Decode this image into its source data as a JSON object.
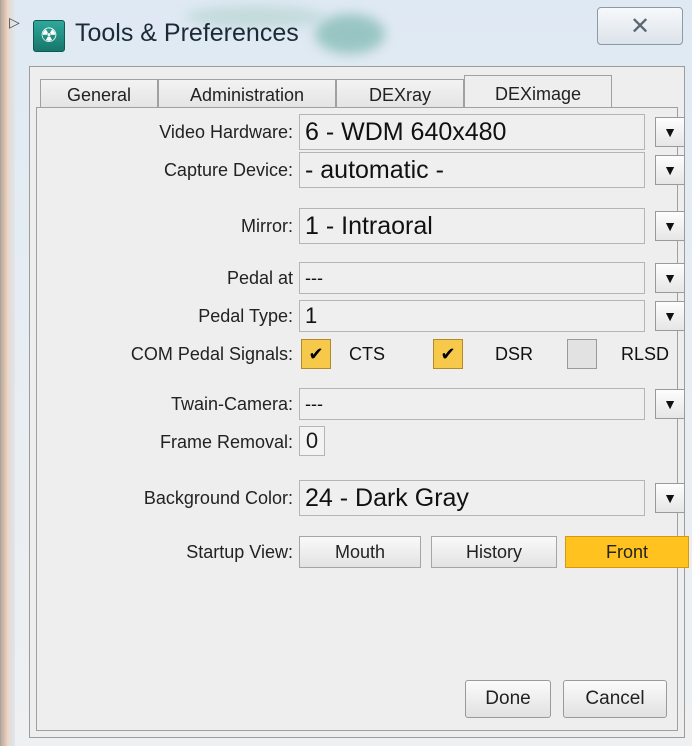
{
  "window": {
    "title": "Tools & Preferences",
    "close_glyph": "✕",
    "icon": "radiation-icon"
  },
  "tabs": [
    {
      "label": "General",
      "active": false
    },
    {
      "label": "Administration",
      "active": false
    },
    {
      "label": "DEXray",
      "active": false
    },
    {
      "label": "DEXimage",
      "active": true
    }
  ],
  "form": {
    "video_hardware": {
      "label": "Video Hardware:",
      "value": "6 - WDM 640x480"
    },
    "capture_device": {
      "label": "Capture Device:",
      "value": "- automatic -"
    },
    "mirror": {
      "label": "Mirror:",
      "value": "1 - Intraoral"
    },
    "pedal_at": {
      "label": "Pedal at",
      "value": "---"
    },
    "pedal_type": {
      "label": "Pedal Type:",
      "value": "1"
    },
    "com_pedal_signals": {
      "label": "COM Pedal Signals:",
      "options": [
        {
          "label": "CTS",
          "checked": true
        },
        {
          "label": "DSR",
          "checked": true
        },
        {
          "label": "RLSD",
          "checked": false
        }
      ]
    },
    "twain_camera": {
      "label": "Twain-Camera:",
      "value": "---"
    },
    "frame_removal": {
      "label": "Frame Removal:",
      "value": "0"
    },
    "background_color": {
      "label": "Background Color:",
      "value": "24 - Dark Gray"
    },
    "startup_view": {
      "label": "Startup View:",
      "options": [
        {
          "label": "Mouth",
          "active": false
        },
        {
          "label": "History",
          "active": false
        },
        {
          "label": "Front",
          "active": true
        }
      ]
    }
  },
  "buttons": {
    "done": "Done",
    "cancel": "Cancel"
  },
  "glyphs": {
    "dropdown": "▼",
    "checkmark": "✔"
  },
  "colors": {
    "accent_selected": "#ffc21f",
    "checkbox_checked": "#f7c94a",
    "app_icon": "#2fa89a"
  }
}
